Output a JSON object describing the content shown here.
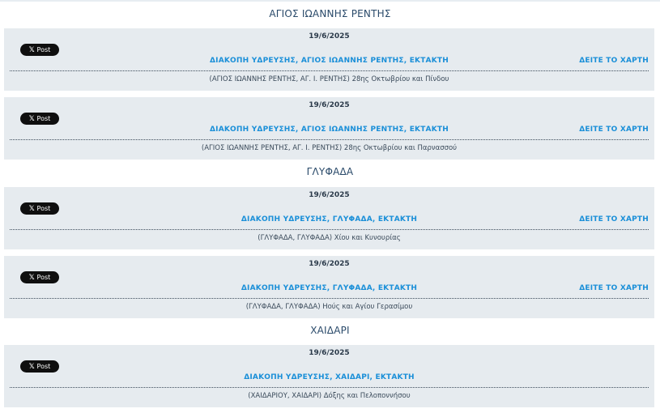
{
  "x_button_label": "Post",
  "x_icon_glyph": "𝕏",
  "map_link_label": "ΔΕΙΤΕ ΤΟ ΧΑΡΤΗ",
  "sections": [
    {
      "title": "ΑΓΙΟΣ ΙΩΑΝΝΗΣ ΡΕΝΤΗΣ",
      "cards": [
        {
          "date": "19/6/2025",
          "headline": "ΔΙΑΚΟΠΗ ΥΔΡΕΥΣΗΣ, ΑΓΙΟΣ ΙΩΑΝΝΗΣ ΡΕΝΤΗΣ, ΕΚΤΑΚΤΗ",
          "address": "(ΑΓΙΟΣ ΙΩΑΝΝΗΣ ΡΕΝΤΗΣ, ΑΓ. Ι. ΡΕΝΤΗΣ) 28ης Οκτωβρίου και Πίνδου",
          "has_map_link": true
        },
        {
          "date": "19/6/2025",
          "headline": "ΔΙΑΚΟΠΗ ΥΔΡΕΥΣΗΣ, ΑΓΙΟΣ ΙΩΑΝΝΗΣ ΡΕΝΤΗΣ, ΕΚΤΑΚΤΗ",
          "address": "(ΑΓΙΟΣ ΙΩΑΝΝΗΣ ΡΕΝΤΗΣ, ΑΓ. Ι. ΡΕΝΤΗΣ) 28ης Οκτωβρίου και Παρνασσού",
          "has_map_link": true
        }
      ]
    },
    {
      "title": "ΓΛΥΦΑΔΑ",
      "cards": [
        {
          "date": "19/6/2025",
          "headline": "ΔΙΑΚΟΠΗ ΥΔΡΕΥΣΗΣ, ΓΛΥΦΑΔΑ, ΕΚΤΑΚΤΗ",
          "address": "(ΓΛΥΦΑΔΑ, ΓΛΥΦΑΔΑ) Χίου και Κυνουρίας",
          "has_map_link": true
        },
        {
          "date": "19/6/2025",
          "headline": "ΔΙΑΚΟΠΗ ΥΔΡΕΥΣΗΣ, ΓΛΥΦΑΔΑ, ΕΚΤΑΚΤΗ",
          "address": "(ΓΛΥΦΑΔΑ, ΓΛΥΦΑΔΑ) Ηούς και Αγίου Γερασίμου",
          "has_map_link": true
        }
      ]
    },
    {
      "title": "ΧΑΙΔΑΡΙ",
      "cards": [
        {
          "date": "19/6/2025",
          "headline": "ΔΙΑΚΟΠΗ ΥΔΡΕΥΣΗΣ, ΧΑΙΔΑΡΙ, ΕΚΤΑΚΤΗ",
          "address": "(ΧΑΙΔΑΡΙΟΥ, ΧΑΙΔΑΡΙ) Δόξης και Πελοποννήσου",
          "has_map_link": false
        }
      ]
    }
  ]
}
